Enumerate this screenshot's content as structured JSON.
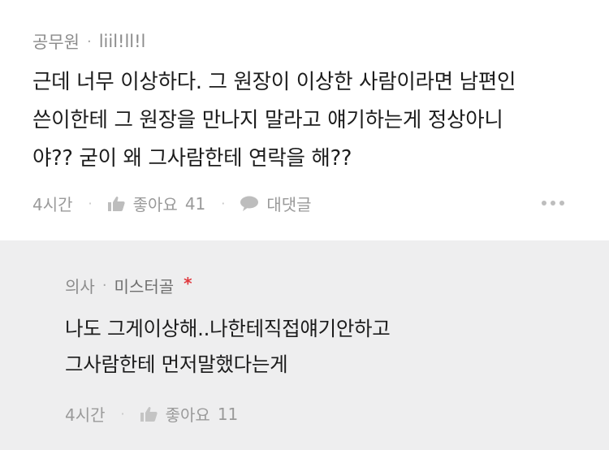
{
  "comment": {
    "job": "공무원",
    "nickname": "liil!ll!l",
    "lines": [
      "근데 너무 이상하다. 그 원장이 이상한 사람이라면 남편인",
      "쓴이한테 그 원장을 만나지 말라고 얘기하는게 정상아니",
      "야?? 굳이 왜 그사람한테 연락을 해??"
    ],
    "time": "4시간",
    "like_label": "좋아요",
    "like_count": "41",
    "reply_label": "대댓글",
    "more_icon": "more-dots-icon"
  },
  "reply": {
    "job": "의사",
    "nickname": "미스터골",
    "badge": "*",
    "lines": [
      "나도 그게이상해..나한테직접얘기안하고",
      "그사람한테 먼저말했다는게"
    ],
    "time": "4시간",
    "like_label": "좋아요",
    "like_count": "11"
  },
  "colors": {
    "reply_background": "#eeeeef",
    "badge": "#e0393e",
    "meta_text": "#9a9a9a"
  }
}
